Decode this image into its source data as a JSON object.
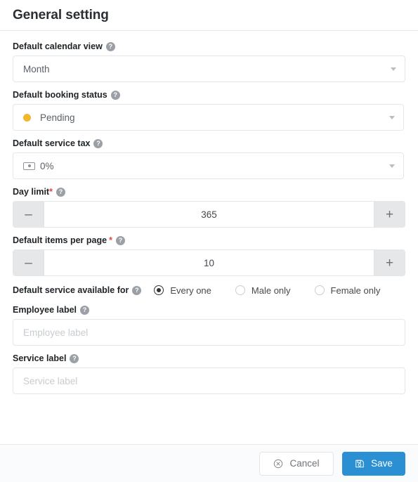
{
  "header": {
    "title": "General setting"
  },
  "help_icon_glyph": "?",
  "fields": {
    "calendar_view": {
      "label": "Default calendar view",
      "value": "Month",
      "icon": "chevron-down-icon"
    },
    "booking_status": {
      "label": "Default booking status",
      "value": "Pending",
      "dot_color": "#f3b72e",
      "icon": "status-dot-icon"
    },
    "service_tax": {
      "label": "Default service tax",
      "value": "0%",
      "icon": "money-icon"
    },
    "day_limit": {
      "label": "Day limit",
      "required_marker": "*",
      "value": "365",
      "decrement_label": "–",
      "increment_label": "+"
    },
    "items_per_page": {
      "label": "Default items per page",
      "required_marker": "*",
      "value": "10",
      "decrement_label": "–",
      "increment_label": "+"
    },
    "service_available_for": {
      "label": "Default service available for",
      "options": [
        {
          "label": "Every one",
          "selected": true
        },
        {
          "label": "Male only",
          "selected": false
        },
        {
          "label": "Female only",
          "selected": false
        }
      ]
    },
    "employee_label": {
      "label": "Employee label",
      "value": "",
      "placeholder": "Employee label"
    },
    "service_label": {
      "label": "Service label",
      "value": "",
      "placeholder": "Service label"
    }
  },
  "footer": {
    "cancel_label": "Cancel",
    "cancel_icon": "circle-x-icon",
    "save_label": "Save",
    "save_icon": "floppy-disk-icon",
    "save_color": "#2b8fd4"
  }
}
